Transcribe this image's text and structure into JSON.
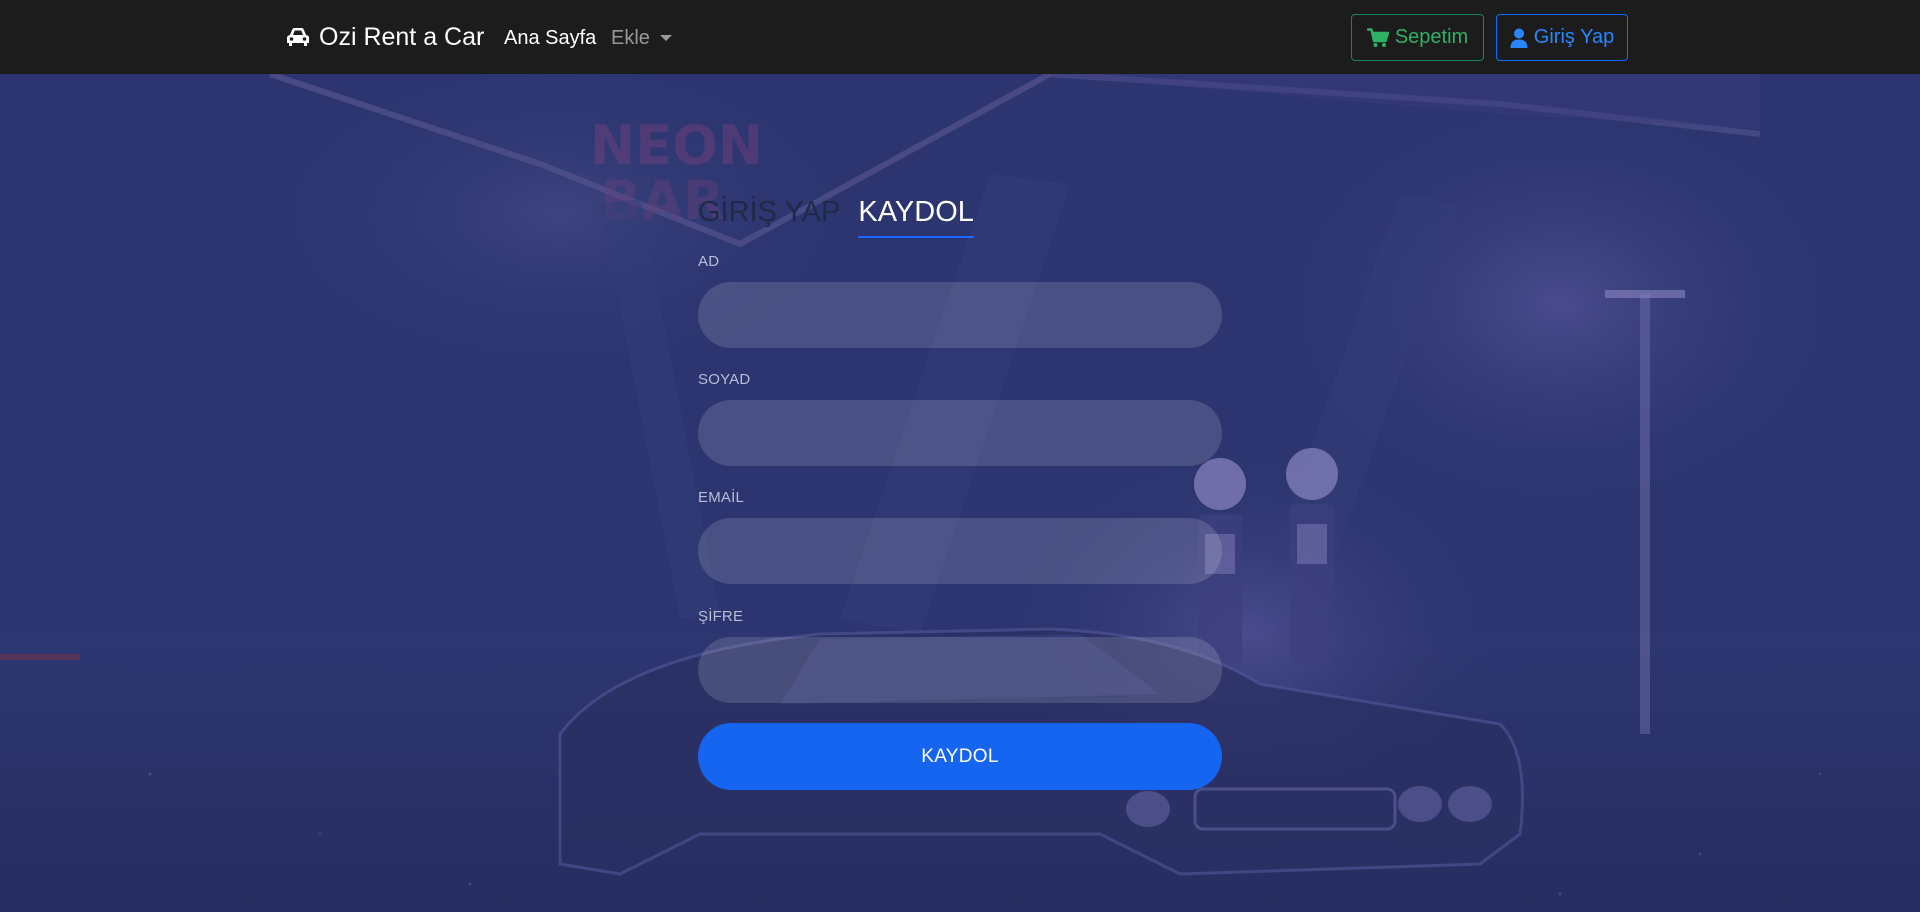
{
  "navbar": {
    "brand": "Ozi Rent a Car",
    "home_link": "Ana Sayfa",
    "add_dropdown": "Ekle",
    "cart_button": "Sepetim",
    "login_button": "Giriş Yap"
  },
  "form": {
    "tabs": [
      "GİRİŞ YAP",
      "KAYDOL"
    ],
    "active_tab": "KAYDOL",
    "fields": [
      {
        "label": "AD",
        "value": ""
      },
      {
        "label": "SOYAD",
        "value": ""
      },
      {
        "label": "EMAİL",
        "value": ""
      },
      {
        "label": "ŞİFRE",
        "value": ""
      }
    ],
    "submit": "KAYDOL"
  },
  "colors": {
    "navbar_bg": "#1c1c1c",
    "background_overlay": "#2c3570",
    "cart_accent": "#198754",
    "login_accent": "#0d6efd",
    "submit_bg": "#1565f0",
    "active_tab_underline": "#1a66ff"
  },
  "icons": {
    "brand": "car-icon",
    "cart": "shopping-cart-icon",
    "login": "user-icon",
    "dropdown": "caret-down-icon"
  }
}
